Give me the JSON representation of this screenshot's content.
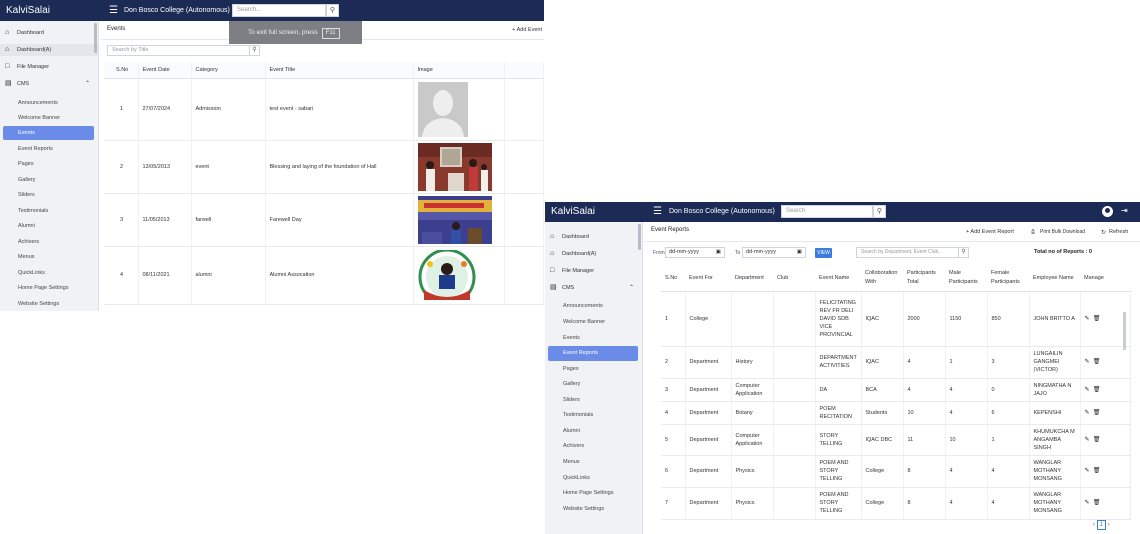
{
  "brand": "KalviSalai",
  "college": "Don Bosco College (Autonomous)",
  "search_placeholder": "Search",
  "search_placeholder_a": "Search...",
  "fullscreen_toast": {
    "text": "To exit full screen, press",
    "key": "F11"
  },
  "sidebar": {
    "top_items": [
      {
        "icon": "home-icon",
        "label": "Dashboard"
      },
      {
        "icon": "home-icon",
        "label": "Dashboard(A)"
      },
      {
        "icon": "folder-icon",
        "label": "File Manager"
      },
      {
        "icon": "cms-icon",
        "label": "CMS"
      }
    ],
    "cms_items": [
      "Announcements",
      "Welcome Banner",
      "Events",
      "Event Reports",
      "Pages",
      "Gallery",
      "Sliders",
      "Testimonials",
      "Alumni",
      "Achivers",
      "Menus",
      "QuickLinks",
      "Home Page Settings",
      "Website Settings"
    ]
  },
  "events_page": {
    "title": "Events",
    "add_label": "+ Add Event",
    "search_placeholder": "Search by Title",
    "columns": [
      "S.No",
      "Event Date",
      "Category",
      "Event Title",
      "Image"
    ],
    "rows": [
      {
        "sno": "1",
        "date": "27/07/2024",
        "category": "Admission",
        "title": "test event - sabari",
        "image": "avatar-placeholder"
      },
      {
        "sno": "2",
        "date": "13/05/2013",
        "category": "event",
        "title": "Blessing and laying of the foundation of Hall",
        "image": "photo-ceremony"
      },
      {
        "sno": "3",
        "date": "11/05/2013",
        "category": "farwell",
        "title": "Farewell Day",
        "image": "photo-farewell"
      },
      {
        "sno": "4",
        "date": "08/11/2021",
        "category": "alumni",
        "title": "Alumni Assocation",
        "image": "photo-logo"
      }
    ]
  },
  "reports_page": {
    "title": "Event Reports",
    "add_label": "+ Add Event Report",
    "print_label": "Print Bulk Download",
    "refresh_label": "Refresh",
    "from_label": "From",
    "to_label": "To",
    "date_placeholder": "dd-mm-yyyy",
    "view_label": "VIEW",
    "search_placeholder": "Search by Department, Event Club..",
    "total_label": "Total no of Reports : 0",
    "columns": [
      "S.No",
      "Event For",
      "Department",
      "Club",
      "Event Name",
      "Colloboration With",
      "Participants Total",
      "Male Participants",
      "Female Participants",
      "Employee Name",
      "Manage"
    ],
    "rows": [
      {
        "sno": "1",
        "for": "College",
        "dept": "",
        "club": "",
        "name": "FELICITATING REV FR DELI DAVID SDB VICE PROVINCIAL",
        "collab": "IQAC",
        "total": "2000",
        "male": "1150",
        "female": "850",
        "emp": "JOHN BRITTO A"
      },
      {
        "sno": "2",
        "for": "Department",
        "dept": "History",
        "club": "",
        "name": "DEPARTMENT ACTIVITIES",
        "collab": "IQAC",
        "total": "4",
        "male": "1",
        "female": "3",
        "emp": "LUNGAILIN GANGMEI (VICTOR)"
      },
      {
        "sno": "3",
        "for": "Department",
        "dept": "Computer Application",
        "club": "",
        "name": "DA",
        "collab": "BCA",
        "total": "4",
        "male": "4",
        "female": "0",
        "emp": "NINGMATHA N JAJO"
      },
      {
        "sno": "4",
        "for": "Department",
        "dept": "Botany",
        "club": "",
        "name": "POEM RECITATION",
        "collab": "Students",
        "total": "10",
        "male": "4",
        "female": "6",
        "emp": "KEPENSHI"
      },
      {
        "sno": "5",
        "for": "Department",
        "dept": "Computer Application",
        "club": "",
        "name": "STORY TELLING",
        "collab": "IQAC DBC",
        "total": "11",
        "male": "10",
        "female": "1",
        "emp": "KHUMUKCHA M ANGAMBA SINGH"
      },
      {
        "sno": "6",
        "for": "Department",
        "dept": "Physics",
        "club": "",
        "name": "POEM AND STORY TELLING",
        "collab": "College",
        "total": "8",
        "male": "4",
        "female": "4",
        "emp": "WANGLAR MOTHANY MONSANG"
      },
      {
        "sno": "7",
        "for": "Department",
        "dept": "Physics",
        "club": "",
        "name": "POEM AND STORY TELLING",
        "collab": "College",
        "total": "8",
        "male": "4",
        "female": "4",
        "emp": "WANGLAR MOTHANY MONSANG"
      }
    ],
    "pager": {
      "current": "1"
    }
  }
}
